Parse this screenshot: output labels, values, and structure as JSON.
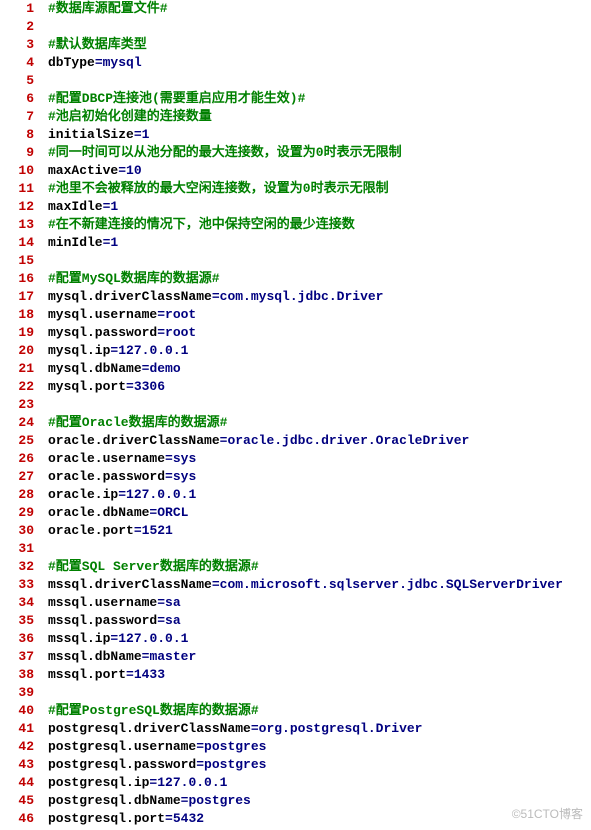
{
  "watermark": "©51CTO博客",
  "lines": [
    {
      "n": 1,
      "type": "comment",
      "text": "#数据库源配置文件#"
    },
    {
      "n": 2,
      "type": "blank"
    },
    {
      "n": 3,
      "type": "comment",
      "text": "#默认数据库类型"
    },
    {
      "n": 4,
      "type": "kv",
      "key": "dbType",
      "value": "mysql"
    },
    {
      "n": 5,
      "type": "blank"
    },
    {
      "n": 6,
      "type": "comment",
      "text": "#配置DBCP连接池(需要重启应用才能生效)#"
    },
    {
      "n": 7,
      "type": "comment",
      "text": "#池启初始化创建的连接数量"
    },
    {
      "n": 8,
      "type": "kv",
      "key": "initialSize",
      "value": "1"
    },
    {
      "n": 9,
      "type": "comment",
      "text": "#同一时间可以从池分配的最大连接数，设置为0时表示无限制"
    },
    {
      "n": 10,
      "type": "kv",
      "key": "maxActive",
      "value": "10"
    },
    {
      "n": 11,
      "type": "comment",
      "text": "#池里不会被释放的最大空闲连接数，设置为0时表示无限制"
    },
    {
      "n": 12,
      "type": "kv",
      "key": "maxIdle",
      "value": "1"
    },
    {
      "n": 13,
      "type": "comment",
      "text": "#在不新建连接的情况下，池中保持空闲的最少连接数"
    },
    {
      "n": 14,
      "type": "kv",
      "key": "minIdle",
      "value": "1"
    },
    {
      "n": 15,
      "type": "blank"
    },
    {
      "n": 16,
      "type": "comment",
      "text": "#配置MySQL数据库的数据源#"
    },
    {
      "n": 17,
      "type": "kv",
      "key": "mysql.driverClassName",
      "value": "com.mysql.jdbc.Driver"
    },
    {
      "n": 18,
      "type": "kv",
      "key": "mysql.username",
      "value": "root"
    },
    {
      "n": 19,
      "type": "kv",
      "key": "mysql.password",
      "value": "root"
    },
    {
      "n": 20,
      "type": "kv",
      "key": "mysql.ip",
      "value": "127.0.0.1"
    },
    {
      "n": 21,
      "type": "kv",
      "key": "mysql.dbName",
      "value": "demo"
    },
    {
      "n": 22,
      "type": "kv",
      "key": "mysql.port",
      "value": "3306"
    },
    {
      "n": 23,
      "type": "blank"
    },
    {
      "n": 24,
      "type": "comment",
      "text": "#配置Oracle数据库的数据源#"
    },
    {
      "n": 25,
      "type": "kv",
      "key": "oracle.driverClassName",
      "value": "oracle.jdbc.driver.OracleDriver"
    },
    {
      "n": 26,
      "type": "kv",
      "key": "oracle.username",
      "value": "sys"
    },
    {
      "n": 27,
      "type": "kv",
      "key": "oracle.password",
      "value": "sys"
    },
    {
      "n": 28,
      "type": "kv",
      "key": "oracle.ip",
      "value": "127.0.0.1"
    },
    {
      "n": 29,
      "type": "kv",
      "key": "oracle.dbName",
      "value": "ORCL"
    },
    {
      "n": 30,
      "type": "kv",
      "key": "oracle.port",
      "value": "1521"
    },
    {
      "n": 31,
      "type": "blank"
    },
    {
      "n": 32,
      "type": "comment",
      "text": "#配置SQL Server数据库的数据源#"
    },
    {
      "n": 33,
      "type": "kv",
      "key": "mssql.driverClassName",
      "value": "com.microsoft.sqlserver.jdbc.SQLServerDriver"
    },
    {
      "n": 34,
      "type": "kv",
      "key": "mssql.username",
      "value": "sa"
    },
    {
      "n": 35,
      "type": "kv",
      "key": "mssql.password",
      "value": "sa"
    },
    {
      "n": 36,
      "type": "kv",
      "key": "mssql.ip",
      "value": "127.0.0.1"
    },
    {
      "n": 37,
      "type": "kv",
      "key": "mssql.dbName",
      "value": "master"
    },
    {
      "n": 38,
      "type": "kv",
      "key": "mssql.port",
      "value": "1433"
    },
    {
      "n": 39,
      "type": "blank"
    },
    {
      "n": 40,
      "type": "comment",
      "text": "#配置PostgreSQL数据库的数据源#"
    },
    {
      "n": 41,
      "type": "kv",
      "key": "postgresql.driverClassName",
      "value": "org.postgresql.Driver"
    },
    {
      "n": 42,
      "type": "kv",
      "key": "postgresql.username",
      "value": "postgres"
    },
    {
      "n": 43,
      "type": "kv",
      "key": "postgresql.password",
      "value": "postgres"
    },
    {
      "n": 44,
      "type": "kv",
      "key": "postgresql.ip",
      "value": "127.0.0.1"
    },
    {
      "n": 45,
      "type": "kv",
      "key": "postgresql.dbName",
      "value": "postgres"
    },
    {
      "n": 46,
      "type": "kv",
      "key": "postgresql.port",
      "value": "5432"
    }
  ]
}
